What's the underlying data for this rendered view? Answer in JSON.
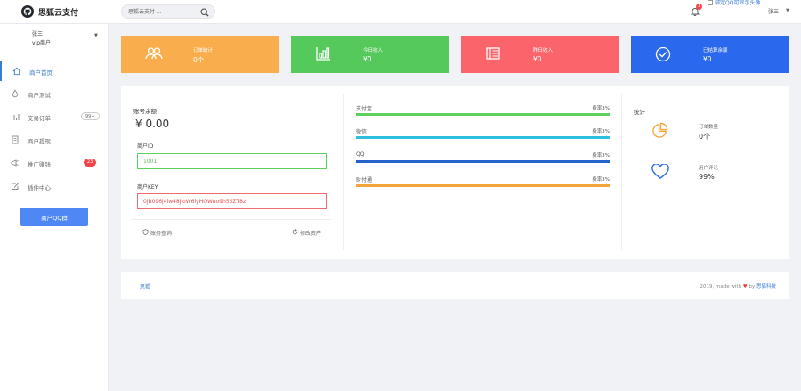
{
  "app": {
    "name": "思狐云支付"
  },
  "topbar": {
    "search_placeholder": "思狐云支付 ...",
    "notification_count": "1",
    "avatar_alt": "绑定QQ可显示头像",
    "user": "张三"
  },
  "sidebar": {
    "user_name": "张三",
    "user_level": "vip商户",
    "items": [
      {
        "label": "商户首页",
        "icon": "home-icon",
        "active": true
      },
      {
        "label": "商户测试",
        "icon": "test-icon"
      },
      {
        "label": "交易订单",
        "icon": "chart-icon",
        "badge": "99+"
      },
      {
        "label": "商户提现",
        "icon": "withdraw-icon"
      },
      {
        "label": "推广赚钱",
        "icon": "promote-icon",
        "badge": "23"
      },
      {
        "label": "插件中心",
        "icon": "plugin-icon"
      }
    ],
    "qq_group_button": "商户QQ群"
  },
  "stat_cards": [
    {
      "label": "订单统计",
      "value": "0个",
      "color": "#f9ad4c",
      "icon": "users-icon"
    },
    {
      "label": "今日收入",
      "value": "¥0",
      "color": "#55c95b",
      "icon": "bar-chart-icon"
    },
    {
      "label": "昨日收入",
      "value": "¥0",
      "color": "#fa646a",
      "icon": "ledger-icon"
    },
    {
      "label": "已结算余额",
      "value": "¥0",
      "color": "#2a68ee",
      "icon": "check-circle-icon"
    }
  ],
  "account": {
    "balance_label": "账号余额",
    "balance_value": "¥ 0.00",
    "pid_label": "商户ID",
    "pid_value": "1001",
    "key_label": "商户KEY",
    "key_value": "0jB096j4lw48jioW6lyHOWuo9h55ZT8z",
    "link_settle": "账务查询",
    "link_edit": "修改资产"
  },
  "channels": [
    {
      "name": "支付宝",
      "rate": "费率3%",
      "percent": 100,
      "color": "#5cd161"
    },
    {
      "name": "微信",
      "rate": "费率3%",
      "percent": 100,
      "color": "#2ec0dd"
    },
    {
      "name": "QQ",
      "rate": "费率3%",
      "percent": 100,
      "color": "#2463c9"
    },
    {
      "name": "财付通",
      "rate": "费率3%",
      "percent": 100,
      "color": "#f5a53a"
    }
  ],
  "stats": {
    "title": "统计",
    "items": [
      {
        "label": "订单数量",
        "value": "0个",
        "icon": "pie-chart-icon",
        "color": "#f5a53a"
      },
      {
        "label": "用户评论",
        "value": "99%",
        "icon": "heart-icon",
        "color": "#2a68ee"
      }
    ]
  },
  "footer": {
    "left": "思狐",
    "right_prefix": "2019, made with",
    "right_by": "by",
    "right_brand": "思狐科技"
  }
}
